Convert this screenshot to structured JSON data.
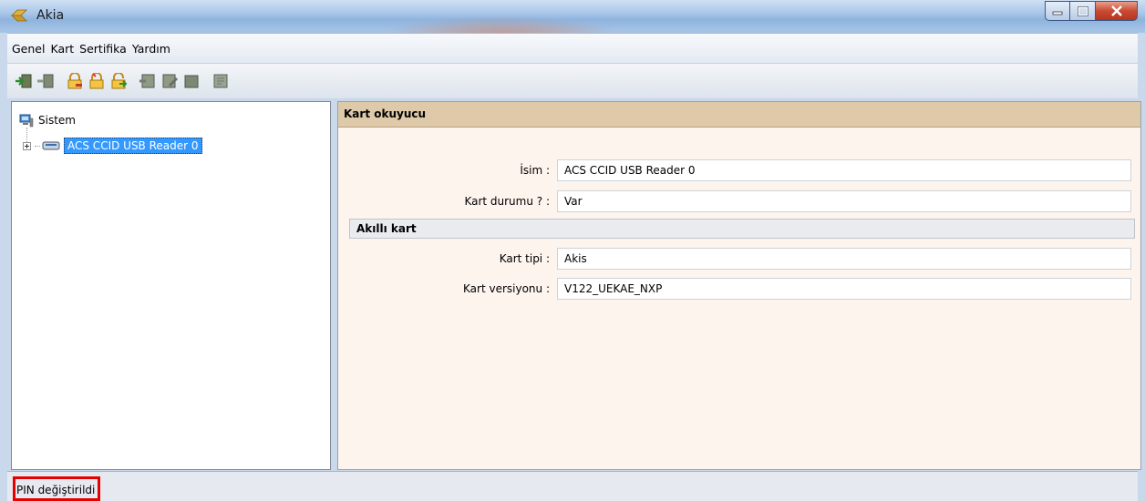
{
  "window": {
    "title": "Akia"
  },
  "menu": [
    "Genel",
    "Kart",
    "Sertifika",
    "Yardım"
  ],
  "toolbar": {
    "buttons": [
      "login-icon",
      "logout-icon",
      "lock-key-icon",
      "lock-icon",
      "unlock-icon",
      "certificate-import-icon",
      "certificate-edit-icon",
      "certificate-delete-icon",
      "certificate-view-icon"
    ]
  },
  "tree": {
    "root": "Sistem",
    "child": "ACS CCID USB Reader 0"
  },
  "detail": {
    "header": "Kart okuyucu",
    "fields": [
      {
        "label": "İsim :",
        "value": "ACS CCID USB Reader 0"
      },
      {
        "label": "Kart durumu ? :",
        "value": "Var"
      }
    ],
    "section": "Akıllı kart",
    "section_fields": [
      {
        "label": "Kart tipi :",
        "value": "Akis"
      },
      {
        "label": "Kart versiyonu :",
        "value": "V122_UEKAE_NXP"
      }
    ]
  },
  "status": {
    "text": "PIN değiştirildi"
  },
  "colors": {
    "selection": "#3399ff",
    "header_bg": "#dec9a9",
    "panel_bg": "#fdf4ee",
    "highlight_border": "#e60000"
  }
}
